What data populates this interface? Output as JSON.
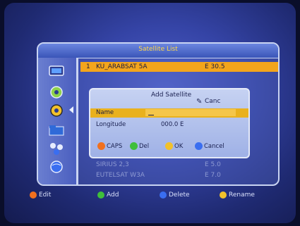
{
  "window": {
    "title": "Satellite List"
  },
  "satellites": [
    {
      "num": "1",
      "name": "KU_ARABSAT 5A",
      "pos": "E 30.5",
      "selected": true
    },
    {
      "num": "",
      "name": "",
      "pos": "",
      "selected": false
    },
    {
      "num": "",
      "name": "SIRIUS 2,3",
      "pos": "E 5.0",
      "selected": false
    },
    {
      "num": "",
      "name": "EUTELSAT W3A",
      "pos": "E 7.0",
      "selected": false
    }
  ],
  "dialog": {
    "title": "Add Satellite",
    "cancel": "Canc",
    "name_label": "Name",
    "name_value": "",
    "longitude_label": "Longitude",
    "longitude_value": "000.0 E",
    "keys": [
      {
        "label": "CAPS",
        "color": "#f0701e"
      },
      {
        "label": "Del",
        "color": "#3fbf3a"
      },
      {
        "label": "OK",
        "color": "#f2c12a"
      },
      {
        "label": "Cancel",
        "color": "#3a6ef0"
      }
    ]
  },
  "bottom": {
    "edit": "Edit",
    "add": "Add",
    "delete": "Delete",
    "rename": "Rename",
    "colors": {
      "edit": "#f0701e",
      "add": "#3fbf3a",
      "delete": "#3a6ef0",
      "rename": "#f2c12a"
    }
  },
  "side_icons": [
    "tv-icon",
    "satellite-dish-icon",
    "gear-icon",
    "folder-icon",
    "network-icon",
    "globe-icon"
  ]
}
